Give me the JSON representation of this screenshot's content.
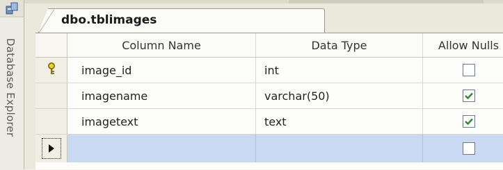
{
  "dock": {
    "label": "Database Explorer",
    "icon": "database-explorer-icon"
  },
  "tab": {
    "title": "dbo.tblimages"
  },
  "grid": {
    "columns": [
      "Column Name",
      "Data Type",
      "Allow Nulls"
    ],
    "rows": [
      {
        "name": "image_id",
        "type": "int",
        "allow_nulls": false,
        "primary_key": true
      },
      {
        "name": "imagename",
        "type": "varchar(50)",
        "allow_nulls": true,
        "primary_key": false
      },
      {
        "name": "imagetext",
        "type": "text",
        "allow_nulls": true,
        "primary_key": false
      },
      {
        "name": "",
        "type": "",
        "allow_nulls": false,
        "primary_key": false,
        "current": true
      }
    ]
  },
  "colors": {
    "selected_row": "#c9d9f2",
    "check_mark": "#2f8a2f",
    "key_icon": "#d4b400"
  }
}
